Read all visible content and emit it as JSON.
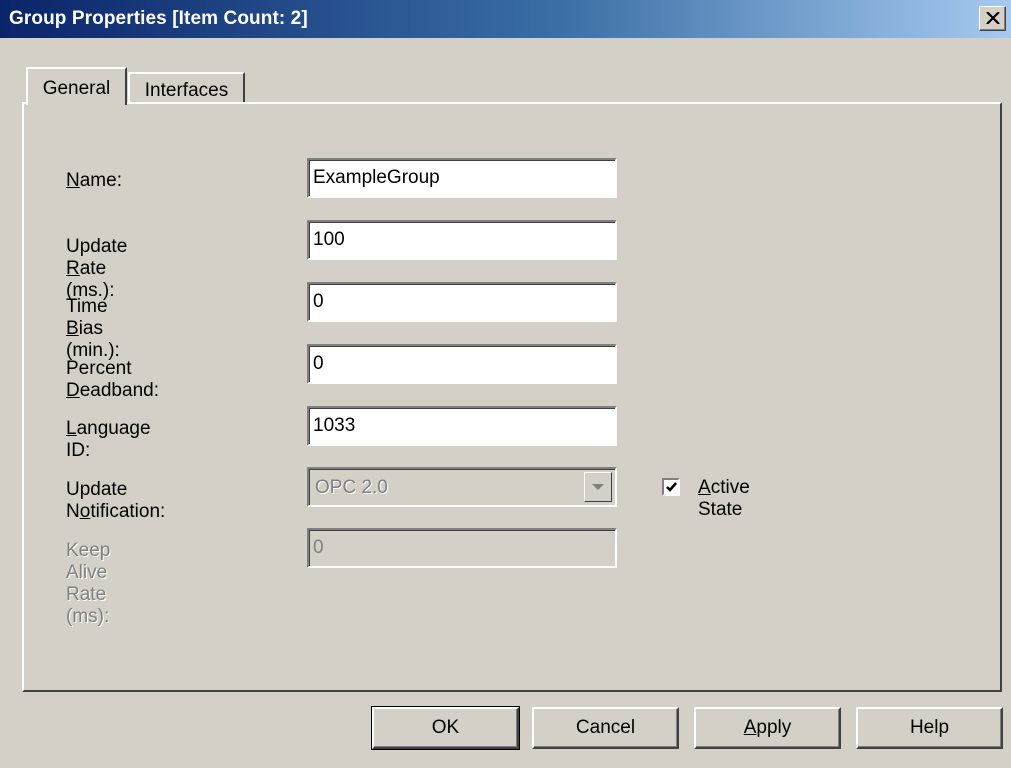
{
  "window": {
    "title": "Group Properties [Item Count: 2]",
    "close_icon": "close-icon"
  },
  "tabs": [
    {
      "label": "General",
      "active": true
    },
    {
      "label": "Interfaces",
      "active": false
    }
  ],
  "form": {
    "name": {
      "label_pre": "",
      "label_key": "N",
      "label_post": "ame:",
      "value": "ExampleGroup"
    },
    "update_rate": {
      "label_pre": "Update ",
      "label_key": "R",
      "label_post": "ate (ms.):",
      "value": "100"
    },
    "time_bias": {
      "label_pre": "Time ",
      "label_key": "B",
      "label_post": "ias (min.):",
      "value": "0"
    },
    "percent_deadband": {
      "label_pre": "Percent ",
      "label_key": "D",
      "label_post": "eadband:",
      "value": "0"
    },
    "language_id": {
      "label_pre": "",
      "label_key": "L",
      "label_post": "anguage ID:",
      "value": "1033"
    },
    "update_notification": {
      "label_pre": "Update N",
      "label_key": "o",
      "label_post": "tification:",
      "value": "OPC 2.0"
    },
    "keep_alive_rate": {
      "label": "Keep Alive Rate (ms):",
      "value": "0"
    },
    "active_state": {
      "label_key": "A",
      "label_post": "ctive State",
      "checked": true
    }
  },
  "buttons": {
    "ok": "OK",
    "cancel": "Cancel",
    "apply_key": "A",
    "apply_post": "pply",
    "help": "Help"
  }
}
